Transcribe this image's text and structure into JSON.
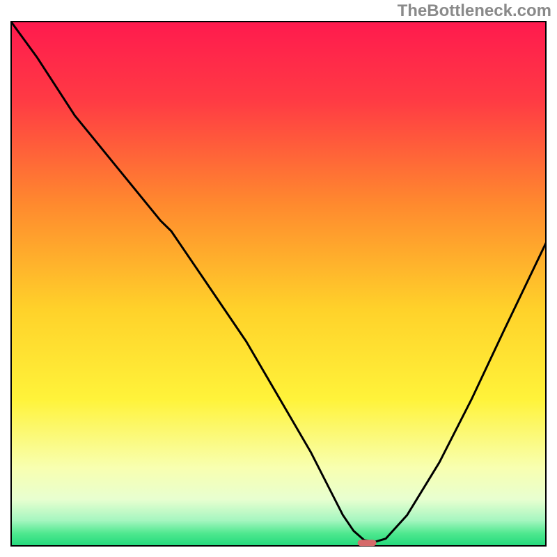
{
  "watermark": "TheBottleneck.com",
  "chart_data": {
    "type": "line",
    "title": "",
    "xlabel": "",
    "ylabel": "",
    "xlim": [
      0,
      100
    ],
    "ylim": [
      0,
      100
    ],
    "grid": false,
    "legend": false,
    "background_gradient": {
      "stops": [
        {
          "offset": 0.0,
          "color": "#ff1a4e"
        },
        {
          "offset": 0.15,
          "color": "#ff3a44"
        },
        {
          "offset": 0.35,
          "color": "#ff8a2e"
        },
        {
          "offset": 0.55,
          "color": "#ffd22a"
        },
        {
          "offset": 0.72,
          "color": "#fff33a"
        },
        {
          "offset": 0.85,
          "color": "#f8ffb0"
        },
        {
          "offset": 0.91,
          "color": "#e8ffd0"
        },
        {
          "offset": 0.95,
          "color": "#a6f6c0"
        },
        {
          "offset": 0.975,
          "color": "#4fe88f"
        },
        {
          "offset": 1.0,
          "color": "#1fd87a"
        }
      ]
    },
    "series": [
      {
        "name": "bottleneck-curve",
        "color": "#000000",
        "x": [
          0,
          5,
          12,
          20,
          28,
          30,
          36,
          44,
          52,
          56,
          60,
          62,
          64,
          66,
          68,
          70,
          74,
          80,
          86,
          92,
          100
        ],
        "y": [
          100,
          93,
          82,
          72,
          62,
          60,
          51,
          39,
          25,
          18,
          10,
          6,
          3,
          1.2,
          0.9,
          1.5,
          6,
          16,
          28,
          41,
          58
        ]
      }
    ],
    "marker": {
      "name": "optimal-point",
      "x": 66.5,
      "y": 0.7,
      "color": "#d56a6a",
      "width": 3.5,
      "height": 1.2
    }
  }
}
